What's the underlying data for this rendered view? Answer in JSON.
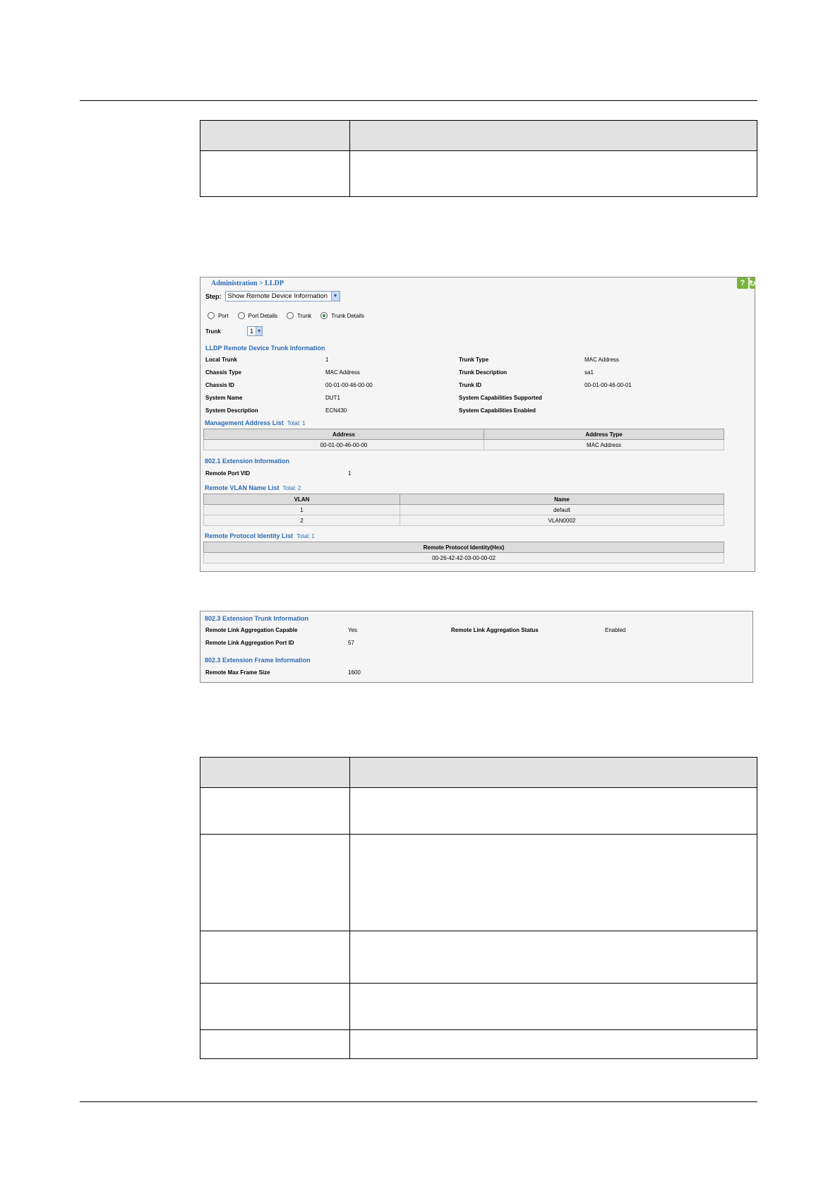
{
  "panel1": {
    "breadcrumb": "Administration > LLDP",
    "help_icon": "?",
    "step_label": "Step:",
    "step_value": "Show Remote Device Information",
    "radios": [
      {
        "label": "Port",
        "selected": false
      },
      {
        "label": "Port Details",
        "selected": false
      },
      {
        "label": "Trunk",
        "selected": false
      },
      {
        "label": "Trunk Details",
        "selected": true
      }
    ],
    "trunk_label": "Trunk",
    "trunk_value": "1",
    "section_trunk": "LLDP Remote Device Trunk Information",
    "left_fields": [
      {
        "label": "Local Trunk",
        "value": "1"
      },
      {
        "label": "Chassis Type",
        "value": "MAC Address"
      },
      {
        "label": "Chassis ID",
        "value": "00-01-00-46-00-00"
      },
      {
        "label": "System Name",
        "value": "DUT1"
      },
      {
        "label": "System Description",
        "value": "ECN430"
      }
    ],
    "right_fields": [
      {
        "label": "Trunk Type",
        "value": "MAC Address"
      },
      {
        "label": "Trunk Description",
        "value": "sa1"
      },
      {
        "label": "Trunk ID",
        "value": "00-01-00-46-00-01"
      },
      {
        "label": "System Capabilities Supported",
        "value": ""
      },
      {
        "label": "System Capabilities Enabled",
        "value": ""
      }
    ],
    "mgmt_title": "Management Address List",
    "mgmt_total": "Total: 1",
    "mgmt_headers": [
      "Address",
      "Address Type"
    ],
    "mgmt_rows": [
      [
        "00-01-00-46-00-00",
        "MAC Address"
      ]
    ],
    "ext_title": "802.1 Extension Information",
    "remote_port_vid_label": "Remote Port VID",
    "remote_port_vid_value": "1",
    "vlan_title": "Remote VLAN Name List",
    "vlan_total": "Total: 2",
    "vlan_headers": [
      "VLAN",
      "Name"
    ],
    "vlan_rows": [
      [
        "1",
        "default"
      ],
      [
        "2",
        "VLAN0002"
      ]
    ],
    "proto_title": "Remote Protocol Identity List",
    "proto_total": "Total: 1",
    "proto_headers": [
      "Remote Protocol Identity(Hex)"
    ],
    "proto_rows": [
      [
        "00-26-42-42-03-00-00-02"
      ]
    ]
  },
  "panel2": {
    "title_trunk": "802.3 Extension Trunk Information",
    "agg_capable_label": "Remote Link Aggregation Capable",
    "agg_capable_value": "Yes",
    "agg_status_label": "Remote Link Aggregation Status",
    "agg_status_value": "Enabled",
    "agg_port_label": "Remote Link Aggregation Port ID",
    "agg_port_value": "57",
    "title_frame": "802.3 Extension Frame Information",
    "max_frame_label": "Remote Max Frame Size",
    "max_frame_value": "1600"
  }
}
